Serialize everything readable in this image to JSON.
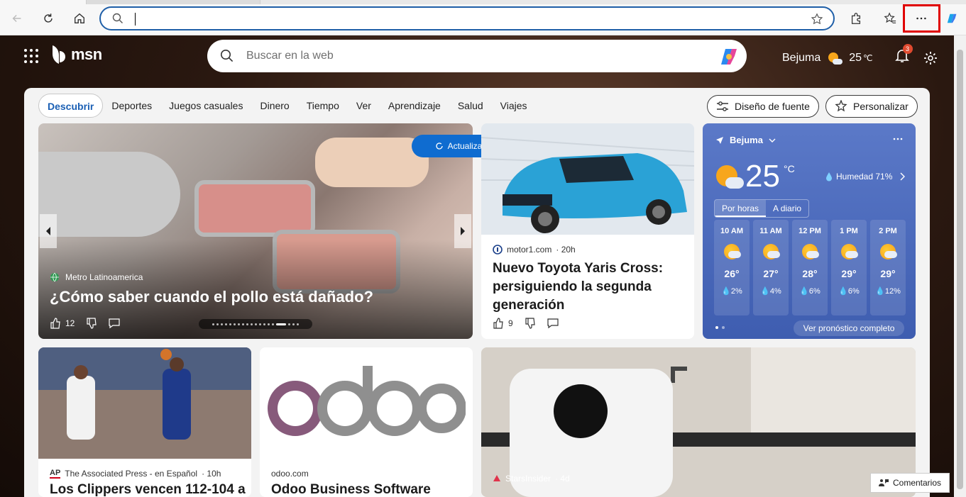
{
  "browser": {
    "address_value": "",
    "toolbar": {
      "back": "back-arrow-icon",
      "refresh": "refresh-icon",
      "home": "home-icon",
      "favorite": "star-icon",
      "extensions": "puzzle-icon",
      "favorites": "favorites-icon",
      "more": "more-icon",
      "copilot": "copilot-icon"
    },
    "colors": {
      "highlight": "#e00000",
      "address_border": "#1f5fa8"
    }
  },
  "msn": {
    "logo_text": "msn",
    "search_placeholder": "Buscar en la web",
    "location": "Bejuma",
    "temp": "25",
    "temp_unit": "℃",
    "notifications": "3"
  },
  "nav": {
    "tabs": [
      "Descubrir",
      "Deportes",
      "Juegos casuales",
      "Dinero",
      "Tiempo",
      "Ver",
      "Aprendizaje",
      "Salud",
      "Viajes"
    ],
    "font_design": "Diseño de fuente",
    "personalize": "Personalizar"
  },
  "hero": {
    "source": "Metro Latinoamerica",
    "title": "¿Cómo saber cuando el pollo está dañado?",
    "likes": "12",
    "refresh_label": "Actualizar historias"
  },
  "car": {
    "source": "motor1.com",
    "age": "· 20h",
    "title": "Nuevo Toyota Yaris Cross: persiguiendo la segunda generación",
    "likes": "9"
  },
  "weather": {
    "location": "Bejuma",
    "temp": "25",
    "unit": "°C",
    "humidity": "Humedad 71%",
    "tab_hourly": "Por horas",
    "tab_daily": "A diario",
    "hours": [
      {
        "time": "10 AM",
        "temp": "26°",
        "precip": "💧2%"
      },
      {
        "time": "11 AM",
        "temp": "27°",
        "precip": "💧4%"
      },
      {
        "time": "12 PM",
        "temp": "28°",
        "precip": "💧6%"
      },
      {
        "time": "1 PM",
        "temp": "29°",
        "precip": "💧6%"
      },
      {
        "time": "2 PM",
        "temp": "29°",
        "precip": "💧12%"
      }
    ],
    "full_forecast": "Ver pronóstico completo"
  },
  "row2": {
    "bball": {
      "source_logo": "AP",
      "source": "The Associated Press - en Español",
      "age": "· 10h",
      "title": "Los Clippers vencen 112-104 a"
    },
    "odoo": {
      "logo_text": "odoo",
      "source": "odoo.com",
      "title": "Odoo Business Software"
    },
    "kitchen": {
      "source": "StarsInsider",
      "age": "· 4d"
    }
  },
  "comments": "Comentarios"
}
